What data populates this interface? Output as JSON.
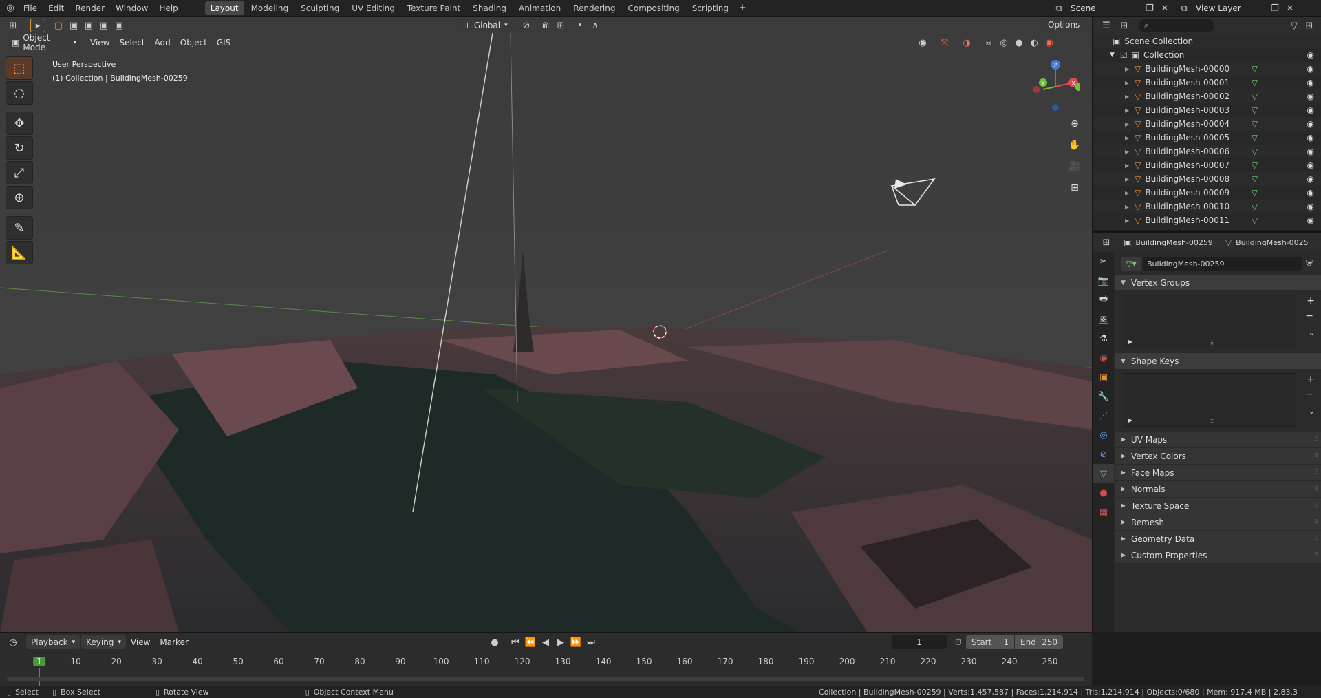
{
  "menus": [
    "File",
    "Edit",
    "Render",
    "Window",
    "Help"
  ],
  "workspaces": [
    "Layout",
    "Modeling",
    "Sculpting",
    "UV Editing",
    "Texture Paint",
    "Shading",
    "Animation",
    "Rendering",
    "Compositing",
    "Scripting"
  ],
  "scene": {
    "label": "Scene",
    "view_layer": "View Layer"
  },
  "header": {
    "mode": "Object Mode",
    "menus": [
      "View",
      "Select",
      "Add",
      "Object",
      "GIS"
    ],
    "orientation": "Global",
    "options": "Options"
  },
  "overlay": {
    "perspective": "User Perspective",
    "context": "(1) Collection | BuildingMesh-00259"
  },
  "outliner": {
    "scene_collection": "Scene Collection",
    "collection": "Collection",
    "items": [
      "BuildingMesh-00000",
      "BuildingMesh-00001",
      "BuildingMesh-00002",
      "BuildingMesh-00003",
      "BuildingMesh-00004",
      "BuildingMesh-00005",
      "BuildingMesh-00006",
      "BuildingMesh-00007",
      "BuildingMesh-00008",
      "BuildingMesh-00009",
      "BuildingMesh-00010",
      "BuildingMesh-00011"
    ]
  },
  "properties": {
    "breadcrumb_object": "BuildingMesh-00259",
    "breadcrumb_mesh": "BuildingMesh-0025",
    "data_name": "BuildingMesh-00259",
    "panels_open": [
      "Vertex Groups",
      "Shape Keys"
    ],
    "panels_closed": [
      "UV Maps",
      "Vertex Colors",
      "Face Maps",
      "Normals",
      "Texture Space",
      "Remesh",
      "Geometry Data",
      "Custom Properties"
    ]
  },
  "timeline": {
    "menus": [
      "Playback",
      "Keying",
      "View",
      "Marker"
    ],
    "current_frame": "1",
    "start_label": "Start",
    "start": "1",
    "end_label": "End",
    "end": "250",
    "ticks": [
      "1",
      "10",
      "20",
      "30",
      "40",
      "50",
      "60",
      "70",
      "80",
      "90",
      "100",
      "110",
      "120",
      "130",
      "140",
      "150",
      "160",
      "170",
      "180",
      "190",
      "200",
      "210",
      "220",
      "230",
      "240",
      "250"
    ]
  },
  "status": {
    "select": "Select",
    "box_select": "Box Select",
    "rotate": "Rotate View",
    "context_menu": "Object Context Menu",
    "stats": "Collection | BuildingMesh-00259 | Verts:1,457,587 | Faces:1,214,914 | Tris:1,214,914 | Objects:0/680 | Mem: 917.4 MB | 2.83.3"
  },
  "colors": {
    "accent": "#e3913a",
    "active_tool": "#ff8a3a",
    "x_axis": "#e0474f",
    "y_axis": "#6fbf3a",
    "z_axis": "#3d7fe0"
  }
}
